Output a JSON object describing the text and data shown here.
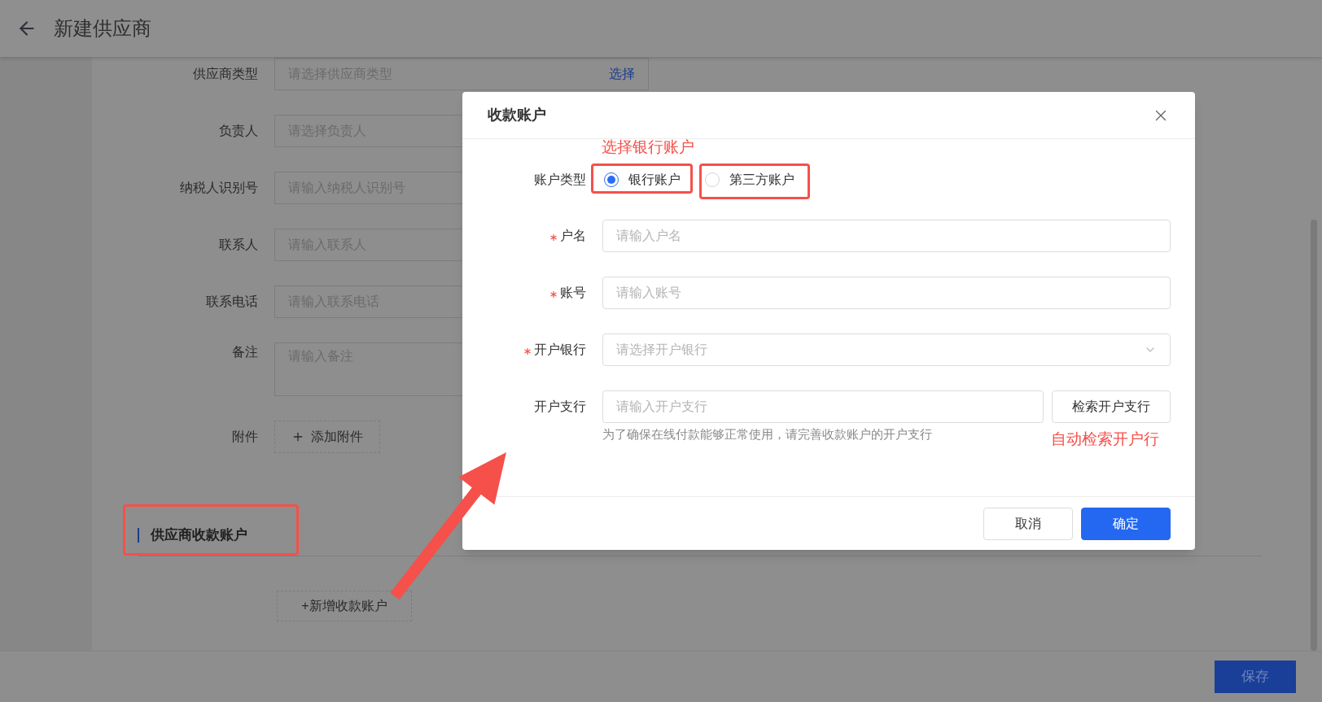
{
  "page": {
    "title": "新建供应商"
  },
  "form": {
    "fields": [
      {
        "label": "供应商类型",
        "kind": "picker",
        "placeholder": "请选择供应商类型",
        "action": "选择"
      },
      {
        "label": "负责人",
        "kind": "input",
        "placeholder": "请选择负责人"
      },
      {
        "label": "纳税人识别号",
        "kind": "input",
        "placeholder": "请输入纳税人识别号"
      },
      {
        "label": "联系人",
        "kind": "input",
        "placeholder": "请输入联系人"
      },
      {
        "label": "联系电话",
        "kind": "input",
        "placeholder": "请输入联系电话"
      },
      {
        "label": "备注",
        "kind": "textarea",
        "placeholder": "请输入备注"
      },
      {
        "label": "附件",
        "kind": "upload",
        "button": "添加附件"
      }
    ]
  },
  "section": {
    "title": "供应商收款账户",
    "add_button": "+新增收款账户"
  },
  "footer": {
    "save": "保存"
  },
  "dialog": {
    "title": "收款账户",
    "account_type": {
      "label": "账户类型",
      "options": [
        {
          "label": "银行账户",
          "selected": true
        },
        {
          "label": "第三方账户",
          "selected": false
        }
      ]
    },
    "fields": [
      {
        "label": "户名",
        "required": true,
        "kind": "input",
        "placeholder": "请输入户名"
      },
      {
        "label": "账号",
        "required": true,
        "kind": "input",
        "placeholder": "请输入账号"
      },
      {
        "label": "开户银行",
        "required": true,
        "kind": "select",
        "placeholder": "请选择开户银行"
      },
      {
        "label": "开户支行",
        "required": false,
        "kind": "search",
        "placeholder": "请输入开户支行",
        "button": "检索开户支行",
        "hint": "为了确保在线付款能够正常使用，请完善收款账户的开户支行"
      }
    ],
    "buttons": [
      {
        "label": "取消",
        "kind": "default"
      },
      {
        "label": "确定",
        "kind": "primary"
      }
    ]
  },
  "annotations": {
    "bank_note": "选择银行账户",
    "branch_note": "自动检索开户行"
  }
}
